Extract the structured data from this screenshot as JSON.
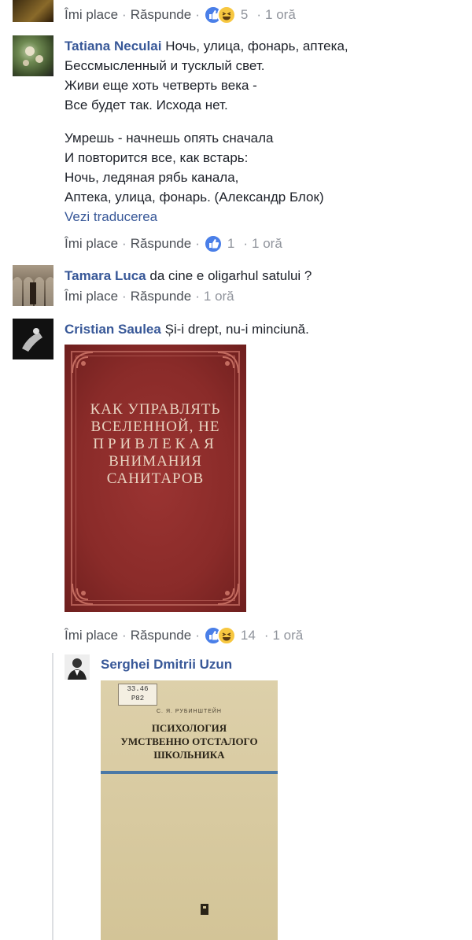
{
  "top_actions": {
    "like": "Îmi place",
    "reply": "Răspunde",
    "count": "5",
    "time": "1 oră"
  },
  "comments": [
    {
      "author": "Tatiana Neculai",
      "first_line": "Ночь, улица, фонарь, аптека,",
      "lines": [
        "Бессмысленный и тусклый свет.",
        "Живи еще хоть четверть века -",
        "Все будет так. Исхода нет."
      ],
      "lines2": [
        "Умрешь - начнешь опять сначала",
        "И повторится все, как встарь:",
        "Ночь, ледяная рябь канала,",
        "Аптека, улица, фонарь. (Александр Блок)"
      ],
      "translate": "Vezi traducerea",
      "actions": {
        "like": "Îmi place",
        "reply": "Răspunde",
        "count": "1",
        "time": "1 oră"
      }
    },
    {
      "author": "Tamara Luca",
      "text": "da cine e oligarhul satului ?",
      "actions": {
        "like": "Îmi place",
        "reply": "Răspunde",
        "time": "1 oră"
      }
    },
    {
      "author": "Cristian Saulea",
      "text": "Și-i drept, nu-i minciună.",
      "book": [
        "КАК УПРАВЛЯТЬ",
        "ВСЕЛЕННОЙ, НЕ",
        "ПРИВЛЕКАЯ",
        "ВНИМАНИЯ",
        "САНИТАРОВ"
      ],
      "actions": {
        "like": "Îmi place",
        "reply": "Răspunde",
        "count": "14",
        "time": "1 oră"
      }
    },
    {
      "author": "Serghei Dmitrii Uzun",
      "book": {
        "sticker": [
          "33.46",
          "Р82"
        ],
        "author_line": "С. Я. РУБИНШТЕЙН",
        "title": [
          "ПСИХОЛОГИЯ",
          "УМСТВЕННО ОТСТАЛОГО",
          "ШКОЛЬНИКА"
        ]
      }
    }
  ],
  "colors": {
    "link": "#385898",
    "meta": "#90949c",
    "like_blue": "#4a7fe8",
    "haha_yellow": "#f7c740",
    "book_red": "#8e2b2a",
    "book_beige": "#d6c69d"
  }
}
